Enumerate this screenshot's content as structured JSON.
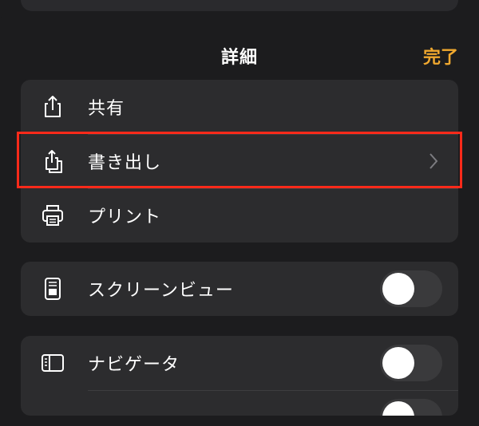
{
  "header": {
    "title": "詳細",
    "done_label": "完了"
  },
  "groups": [
    {
      "items": [
        {
          "label": "共有",
          "icon": "share-icon"
        },
        {
          "label": "書き出し",
          "icon": "export-icon",
          "accessory": "chevron"
        },
        {
          "label": "プリント",
          "icon": "printer-icon"
        }
      ]
    },
    {
      "items": [
        {
          "label": "スクリーンビュー",
          "icon": "screen-view-icon",
          "toggle": "off"
        }
      ]
    },
    {
      "items": [
        {
          "label": "ナビゲータ",
          "icon": "sidebar-icon",
          "toggle": "off"
        },
        {
          "label": "",
          "toggle": "off"
        }
      ]
    }
  ],
  "colors": {
    "accent": "#f0a82f",
    "highlight": "#ff2a1a",
    "background": "#1c1c1e",
    "cell": "#2c2c2e"
  }
}
